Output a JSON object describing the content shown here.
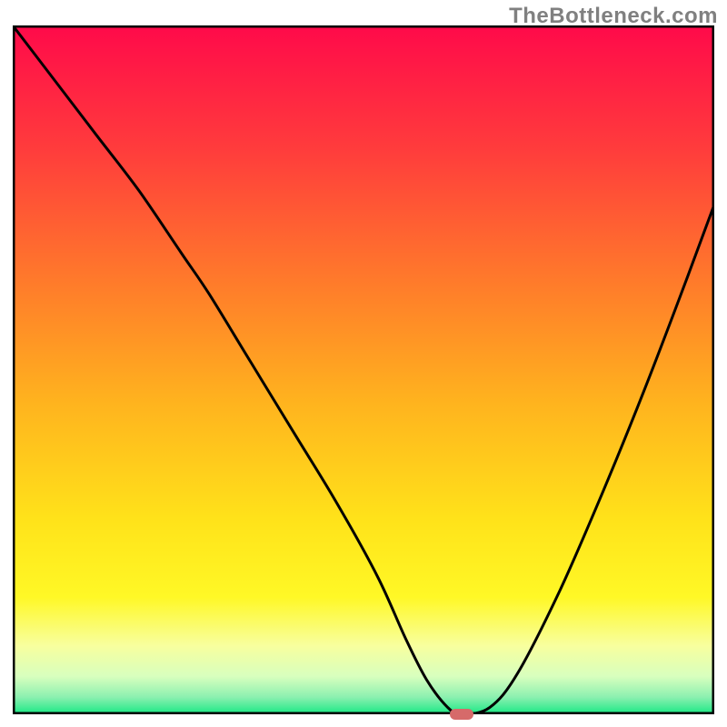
{
  "watermark": "TheBottleneck.com",
  "chart_data": {
    "type": "line",
    "title": "",
    "xlabel": "",
    "ylabel": "",
    "xlim": [
      0,
      100
    ],
    "ylim": [
      0,
      100
    ],
    "grid": false,
    "series": [
      {
        "name": "bottleneck-curve",
        "color": "#000000",
        "x": [
          0,
          6,
          12,
          18,
          24,
          28,
          34,
          40,
          46,
          52,
          56,
          59,
          62,
          64,
          68,
          72,
          78,
          84,
          90,
          96,
          100
        ],
        "y": [
          100,
          92,
          84,
          76,
          67,
          61,
          51,
          41,
          31,
          20,
          11,
          5,
          1,
          0,
          1,
          6,
          18,
          32,
          47,
          63,
          74
        ]
      }
    ],
    "marker": {
      "x": 64,
      "y": 0,
      "color": "#d66a6a"
    },
    "background_gradient": {
      "stops": [
        {
          "offset": 0.0,
          "color": "#ff0a4a"
        },
        {
          "offset": 0.18,
          "color": "#ff3c3c"
        },
        {
          "offset": 0.38,
          "color": "#ff7d2a"
        },
        {
          "offset": 0.55,
          "color": "#ffb41e"
        },
        {
          "offset": 0.72,
          "color": "#ffe31a"
        },
        {
          "offset": 0.83,
          "color": "#fff826"
        },
        {
          "offset": 0.9,
          "color": "#f8ff9e"
        },
        {
          "offset": 0.945,
          "color": "#d8ffbe"
        },
        {
          "offset": 0.975,
          "color": "#8cf0b0"
        },
        {
          "offset": 1.0,
          "color": "#17e884"
        }
      ]
    }
  }
}
